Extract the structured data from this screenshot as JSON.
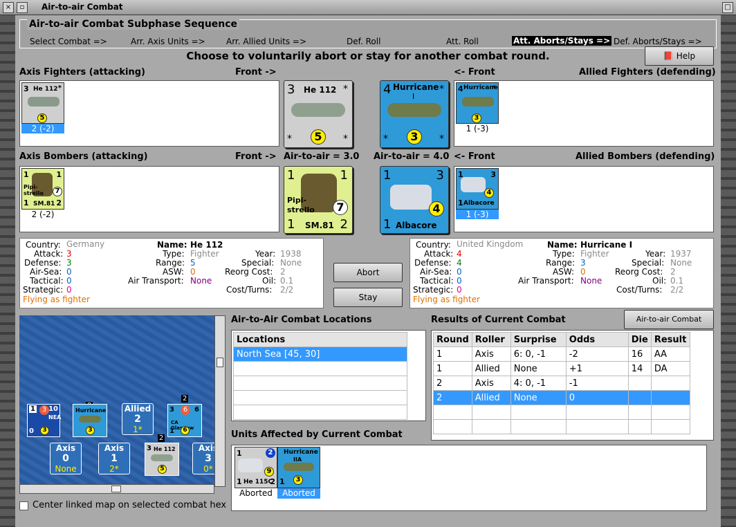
{
  "window": {
    "title": "Air-to-air Combat"
  },
  "sequence": {
    "title": "Air-to-air Combat Subphase Sequence",
    "steps": [
      "Select Combat =>",
      "Arr. Axis Units =>",
      "Arr. Allied Units =>",
      "Def. Roll",
      "Att. Roll",
      "Att. Aborts/Stays =>",
      "Def. Aborts/Stays =>"
    ],
    "active_index": 5
  },
  "message": "Choose to voluntarily abort or stay for another combat round.",
  "help_label": "Help",
  "labels": {
    "axis_fighters": "Axis Fighters (attacking)",
    "front_right": "Front ->",
    "front_left": "<- Front",
    "allied_fighters": "Allied Fighters (defending)",
    "axis_bombers": "Axis Bombers (attacking)",
    "allied_bombers": "Allied Bombers (defending)",
    "axis_a2a": "Air-to-air = 3.0",
    "allied_a2a": "Air-to-air = 4.0"
  },
  "units": {
    "axis_fighter": {
      "name": "He 112",
      "a": "3",
      "factor": "5",
      "caption": "2 (-2)",
      "star": "*"
    },
    "allied_fighter": {
      "name": "Hurricane",
      "sub": "I",
      "a": "4",
      "factor": "3",
      "caption": "1 (-3)",
      "star": "*"
    },
    "axis_bomber": {
      "name": "SM.81",
      "nick1": "Pipi-",
      "nick2": "strello",
      "tl": "1",
      "tr": "1",
      "bl": "1",
      "br": "2",
      "factor": "7",
      "caption": "2 (-2)"
    },
    "allied_bomber": {
      "name": "Albacore",
      "tl": "1",
      "tr": "3",
      "bl": "1",
      "factor": "4",
      "caption": "1 (-3)"
    }
  },
  "axis_info": {
    "country_label": "Country:",
    "country": "Germany",
    "name_label": "Name:",
    "name": "He 112",
    "attack_label": "Attack:",
    "attack": "3",
    "defense_label": "Defense:",
    "defense": "3",
    "airsea_label": "Air-Sea:",
    "airsea": "0",
    "tactical_label": "Tactical:",
    "tactical": "0",
    "strategic_label": "Strategic:",
    "strategic": "0",
    "type_label": "Type:",
    "type": "Fighter",
    "range_label": "Range:",
    "range": "5",
    "asw_label": "ASW:",
    "asw": "0",
    "transport_label": "Air Transport:",
    "transport": "None",
    "year_label": "Year:",
    "year": "1938",
    "special_label": "Special:",
    "special": "None",
    "reorg_label": "Reorg Cost:",
    "reorg": "2",
    "oil_label": "Oil:",
    "oil": "0.1",
    "cost_label": "Cost/Turns:",
    "cost": "2/2",
    "status": "Flying as fighter"
  },
  "allied_info": {
    "country_label": "Country:",
    "country": "United Kingdom",
    "name_label": "Name:",
    "name": "Hurricane I",
    "attack_label": "Attack:",
    "attack": "4",
    "defense_label": "Defense:",
    "defense": "4",
    "airsea_label": "Air-Sea:",
    "airsea": "0",
    "tactical_label": "Tactical:",
    "tactical": "0",
    "strategic_label": "Strategic:",
    "strategic": "0",
    "type_label": "Type:",
    "type": "Fighter",
    "range_label": "Range:",
    "range": "3",
    "asw_label": "ASW:",
    "asw": "0",
    "transport_label": "Air Transport:",
    "transport": "None",
    "year_label": "Year:",
    "year": "1937",
    "special_label": "Special:",
    "special": "None",
    "reorg_label": "Reorg Cost:",
    "reorg": "2",
    "oil_label": "Oil:",
    "oil": "0.1",
    "cost_label": "Cost/Turns:",
    "cost": "2/2",
    "status": "Flying as fighter"
  },
  "buttons": {
    "abort": "Abort",
    "stay": "Stay",
    "chart": "Air-to-air Combat Chart"
  },
  "locations": {
    "title": "Air-to-Air Combat Locations",
    "header": "Locations",
    "rows": [
      "North Sea [45, 30]"
    ]
  },
  "results": {
    "title": "Results of Current Combat",
    "headers": [
      "Round",
      "Roller",
      "Surprise",
      "Odds",
      "Die",
      "Result"
    ],
    "rows": [
      [
        "1",
        "Axis",
        "6: 0, -1",
        "-2",
        "16",
        "AA"
      ],
      [
        "1",
        "Allied",
        "None",
        "+1",
        "14",
        "DA"
      ],
      [
        "2",
        "Axis",
        "4: 0, -1",
        "-1",
        "",
        ""
      ],
      [
        "2",
        "Allied",
        "None",
        "0",
        "",
        ""
      ]
    ],
    "selected_row": 3
  },
  "affected": {
    "title": "Units Affected by Current Combat",
    "units": [
      {
        "name": "He 115C",
        "tl": "1",
        "badge": "2",
        "factor": "9",
        "bl": "1",
        "br": "2",
        "caption": "Aborted"
      },
      {
        "name": "Hurricane",
        "sub": "IIA",
        "factor": "3",
        "bl": "1",
        "caption": "Aborted"
      }
    ]
  },
  "map": {
    "hexes": [
      {
        "top": "Axis",
        "num": "0",
        "bot": "None"
      },
      {
        "top": "Axis",
        "num": "1",
        "bot": "2*"
      },
      {
        "top": "Allied",
        "num": "2",
        "bot": "1*"
      },
      {
        "top": "Axis",
        "num": "3",
        "bot": "0*"
      }
    ],
    "markers": [
      "8",
      "2",
      "2"
    ],
    "ship": {
      "name": "CA Glasgow",
      "tl": "3",
      "badge": "6",
      "tr": "6",
      "bl": "1",
      "factor": "6"
    },
    "nea": {
      "label": "NEA",
      "tl": "1",
      "badge": "3",
      "tr": "10",
      "bl": "0",
      "factor": "3"
    },
    "hurr": {
      "name": "Hurricane",
      "factor": "3"
    },
    "he112": {
      "name": "He 112",
      "tl": "3",
      "factor": "5"
    }
  },
  "center_checkbox": "Center linked map on selected combat hex"
}
